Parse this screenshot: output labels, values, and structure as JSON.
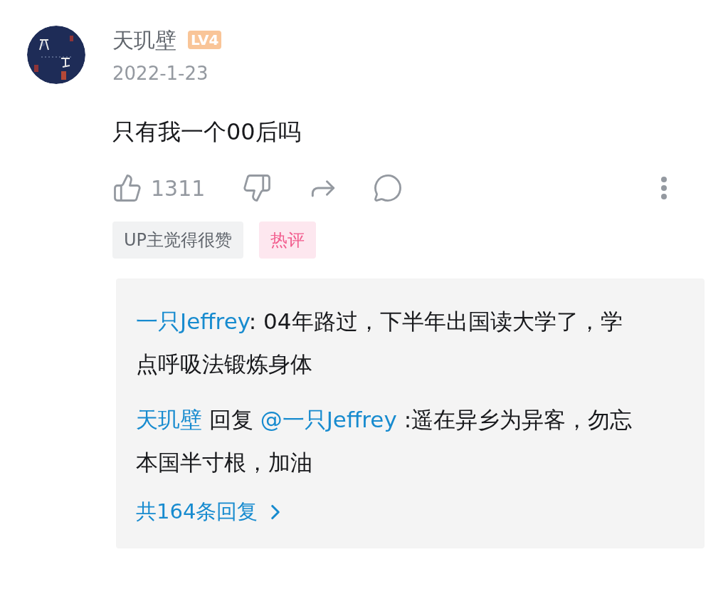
{
  "comment": {
    "author": "天玑壁",
    "level_badge": "LV4",
    "date": "2022-1-23",
    "text": "只有我一个00后吗",
    "like_count": "1311",
    "tags": [
      {
        "label": "UP主觉得很赞",
        "kind": "plain"
      },
      {
        "label": "热评",
        "kind": "hot"
      }
    ]
  },
  "replies": [
    {
      "author": "一只Jeffrey",
      "text": ": 04年路过，下半年出国读大学了，学点呼吸法锻炼身体"
    },
    {
      "author": "天玑壁",
      "reply_word": "回复",
      "target": "@一只Jeffrey",
      "text": " :遥在异乡为异客，勿忘本国半寸根，加油"
    }
  ],
  "more_replies": "共164条回复"
}
